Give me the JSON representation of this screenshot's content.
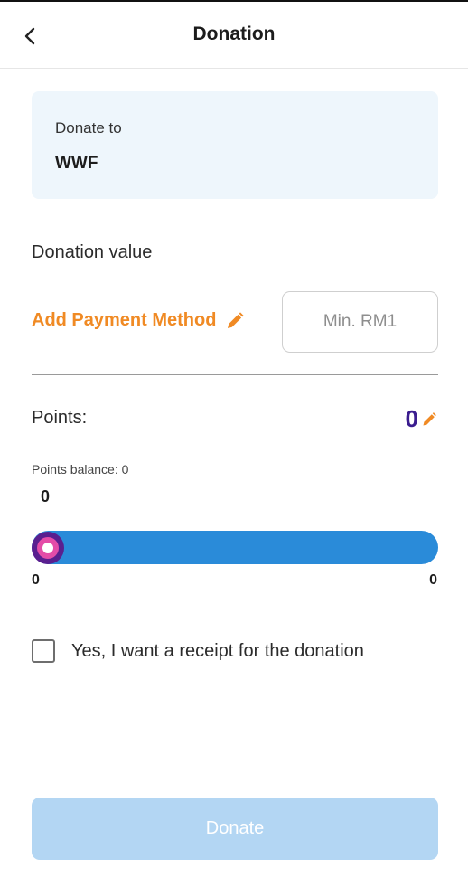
{
  "header": {
    "title": "Donation",
    "back_icon": "chevron-left-icon"
  },
  "recipient": {
    "label": "Donate to",
    "name": "WWF"
  },
  "donation": {
    "label": "Donation value",
    "add_payment_label": "Add Payment Method",
    "edit_icon": "pencil-icon",
    "amount_value": "",
    "amount_placeholder": "Min. RM1"
  },
  "points": {
    "label": "Points:",
    "value": "0",
    "balance_text": "Points balance: 0",
    "slider": {
      "current": "0",
      "min": "0",
      "max": "0"
    }
  },
  "receipt": {
    "label": "Yes, I want a receipt for the donation",
    "checked": false
  },
  "actions": {
    "donate_label": "Donate"
  },
  "colors": {
    "accent_orange": "#f08a24",
    "points_purple": "#3b1d8f",
    "slider_blue": "#2a8bd9",
    "card_bg": "#eef6fc",
    "button_disabled": "#b3d6f3"
  }
}
